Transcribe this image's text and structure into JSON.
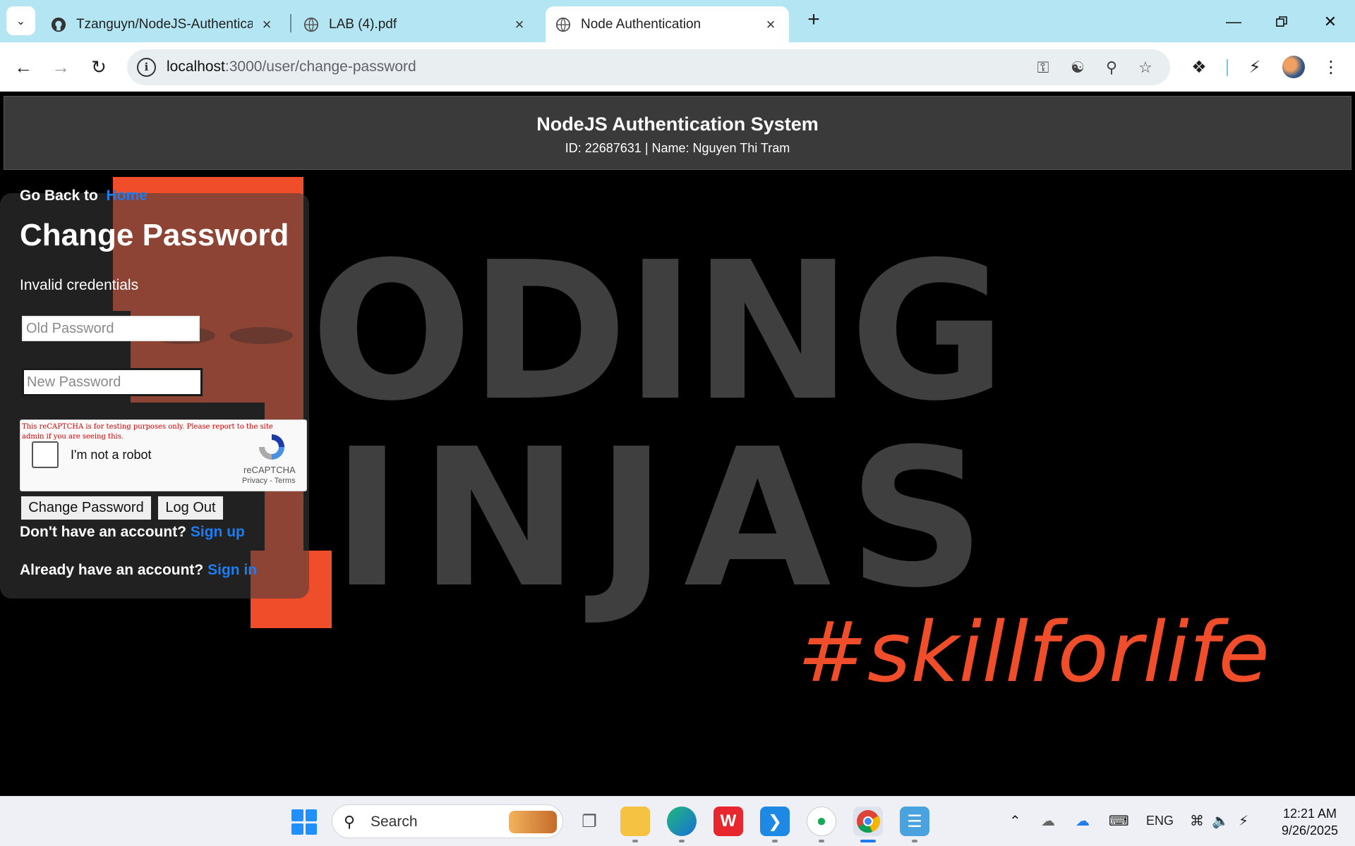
{
  "browser": {
    "tabs": [
      {
        "title": "Tzanguyn/NodeJS-Authenticati",
        "icon": "github-icon"
      },
      {
        "title": "LAB (4).pdf",
        "icon": "globe-icon"
      },
      {
        "title": "Node Authentication",
        "icon": "globe-icon",
        "active": true
      }
    ],
    "url_host": "localhost",
    "url_path": ":3000/user/change-password"
  },
  "header": {
    "title": "NodeJS Authentication System",
    "subtitle": "ID: 22687631 | Name: Nguyen Thi Tram"
  },
  "background": {
    "line1": "ODING",
    "line2": "INJAS",
    "tagline": "#skillforlife"
  },
  "form": {
    "go_back_text": "Go Back to",
    "home_link": "Home",
    "heading": "Change Password",
    "message": "Invalid credentials",
    "old_password_placeholder": "Old Password",
    "new_password_placeholder": "New Password",
    "recaptcha": {
      "warning": "This reCAPTCHA is for testing purposes only. Please report to the site admin if you are seeing this.",
      "label": "I'm not a robot",
      "brand": "reCAPTCHA",
      "privacy": "Privacy",
      "separator": " - ",
      "terms": "Terms"
    },
    "change_button": "Change Password",
    "logout_button": "Log Out",
    "signup_prompt": "Don't have an account?",
    "signup_link": "Sign up",
    "signin_prompt": "Already have an account?",
    "signin_link": "Sign in"
  },
  "taskbar": {
    "search_label": "Search",
    "language": "ENG",
    "time": "12:21 AM",
    "date": "9/26/2025"
  },
  "colors": {
    "link": "#1e7cf0",
    "accent_orange": "#f04e2a",
    "header_bg": "#3a3a3a"
  }
}
